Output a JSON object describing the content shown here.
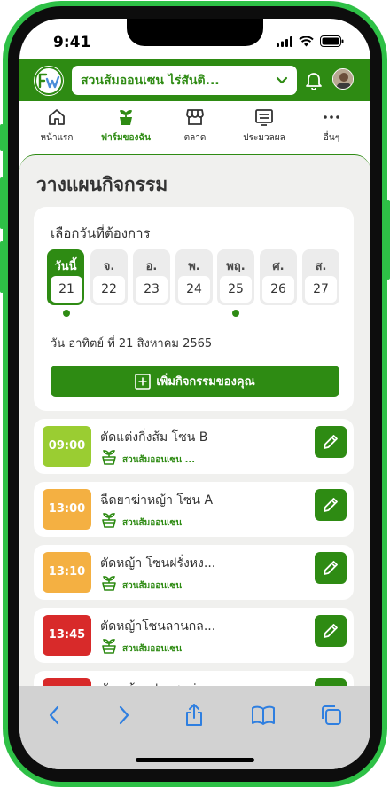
{
  "status": {
    "time": "9:41"
  },
  "header": {
    "farm_name": "สวนส้มออนเซน ไร่สันติ..."
  },
  "tabs": [
    {
      "label": "หน้าแรก",
      "icon": "home-icon"
    },
    {
      "label": "ฟาร์มของฉัน",
      "icon": "plant-pot-icon",
      "active": true
    },
    {
      "label": "ตลาด",
      "icon": "store-icon"
    },
    {
      "label": "ประมวลผล",
      "icon": "list-icon"
    },
    {
      "label": "อื่นๆ",
      "icon": "more-icon"
    }
  ],
  "page_title": "วางแผนกิจกรรม",
  "date_picker": {
    "title": "เลือกวันที่ต้องการ",
    "days": [
      {
        "name": "วันนี้",
        "num": "21",
        "active": true,
        "has_event": true
      },
      {
        "name": "จ.",
        "num": "22"
      },
      {
        "name": "อ.",
        "num": "23"
      },
      {
        "name": "พ.",
        "num": "24"
      },
      {
        "name": "พฤ.",
        "num": "25",
        "has_event": true
      },
      {
        "name": "ศ.",
        "num": "26"
      },
      {
        "name": "ส.",
        "num": "27"
      }
    ],
    "selected_date": "วัน อาทิตย์ ที่ 21 สิงหาคม 2565",
    "add_button": "เพิ่มกิจกรรมของคุณ"
  },
  "activities": [
    {
      "time": "09:00",
      "title": "ตัดแต่งกิ่งส้ม โซน B",
      "farm": "สวนส้มออนเซน ...",
      "color": "#9acd32"
    },
    {
      "time": "13:00",
      "title": "ฉีดยาฆ่าหญ้า โซน A",
      "farm": "สวนส้มออนเซน",
      "color": "#f4b042"
    },
    {
      "time": "13:10",
      "title": "ตัดหญ้า โซนฝรั่งหง...",
      "farm": "สวนส้มออนเซน",
      "color": "#f4b042"
    },
    {
      "time": "13:45",
      "title": "ตัดหญ้าโซนลานกล...",
      "farm": "สวนส้มออนเซน",
      "color": "#d82a2a"
    },
    {
      "time": "",
      "title": "ตัดหญ้าแปลงชมพู่...",
      "farm": "",
      "color": "#d82a2a"
    }
  ],
  "colors": {
    "brand": "#2e8b13",
    "frame": "#2ec046"
  },
  "safari": [
    "back-icon",
    "forward-icon",
    "share-icon",
    "bookmarks-icon",
    "tabs-icon"
  ]
}
